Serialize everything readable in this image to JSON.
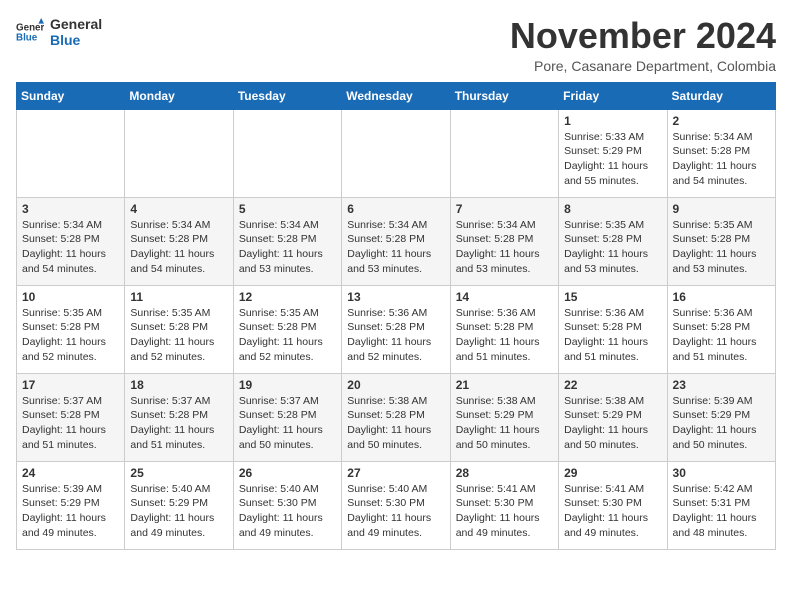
{
  "logo": {
    "line1": "General",
    "line2": "Blue"
  },
  "title": "November 2024",
  "subtitle": "Pore, Casanare Department, Colombia",
  "days_of_week": [
    "Sunday",
    "Monday",
    "Tuesday",
    "Wednesday",
    "Thursday",
    "Friday",
    "Saturday"
  ],
  "weeks": [
    [
      {
        "day": "",
        "info": ""
      },
      {
        "day": "",
        "info": ""
      },
      {
        "day": "",
        "info": ""
      },
      {
        "day": "",
        "info": ""
      },
      {
        "day": "",
        "info": ""
      },
      {
        "day": "1",
        "info": "Sunrise: 5:33 AM\nSunset: 5:29 PM\nDaylight: 11 hours\nand 55 minutes."
      },
      {
        "day": "2",
        "info": "Sunrise: 5:34 AM\nSunset: 5:28 PM\nDaylight: 11 hours\nand 54 minutes."
      }
    ],
    [
      {
        "day": "3",
        "info": "Sunrise: 5:34 AM\nSunset: 5:28 PM\nDaylight: 11 hours\nand 54 minutes."
      },
      {
        "day": "4",
        "info": "Sunrise: 5:34 AM\nSunset: 5:28 PM\nDaylight: 11 hours\nand 54 minutes."
      },
      {
        "day": "5",
        "info": "Sunrise: 5:34 AM\nSunset: 5:28 PM\nDaylight: 11 hours\nand 53 minutes."
      },
      {
        "day": "6",
        "info": "Sunrise: 5:34 AM\nSunset: 5:28 PM\nDaylight: 11 hours\nand 53 minutes."
      },
      {
        "day": "7",
        "info": "Sunrise: 5:34 AM\nSunset: 5:28 PM\nDaylight: 11 hours\nand 53 minutes."
      },
      {
        "day": "8",
        "info": "Sunrise: 5:35 AM\nSunset: 5:28 PM\nDaylight: 11 hours\nand 53 minutes."
      },
      {
        "day": "9",
        "info": "Sunrise: 5:35 AM\nSunset: 5:28 PM\nDaylight: 11 hours\nand 53 minutes."
      }
    ],
    [
      {
        "day": "10",
        "info": "Sunrise: 5:35 AM\nSunset: 5:28 PM\nDaylight: 11 hours\nand 52 minutes."
      },
      {
        "day": "11",
        "info": "Sunrise: 5:35 AM\nSunset: 5:28 PM\nDaylight: 11 hours\nand 52 minutes."
      },
      {
        "day": "12",
        "info": "Sunrise: 5:35 AM\nSunset: 5:28 PM\nDaylight: 11 hours\nand 52 minutes."
      },
      {
        "day": "13",
        "info": "Sunrise: 5:36 AM\nSunset: 5:28 PM\nDaylight: 11 hours\nand 52 minutes."
      },
      {
        "day": "14",
        "info": "Sunrise: 5:36 AM\nSunset: 5:28 PM\nDaylight: 11 hours\nand 51 minutes."
      },
      {
        "day": "15",
        "info": "Sunrise: 5:36 AM\nSunset: 5:28 PM\nDaylight: 11 hours\nand 51 minutes."
      },
      {
        "day": "16",
        "info": "Sunrise: 5:36 AM\nSunset: 5:28 PM\nDaylight: 11 hours\nand 51 minutes."
      }
    ],
    [
      {
        "day": "17",
        "info": "Sunrise: 5:37 AM\nSunset: 5:28 PM\nDaylight: 11 hours\nand 51 minutes."
      },
      {
        "day": "18",
        "info": "Sunrise: 5:37 AM\nSunset: 5:28 PM\nDaylight: 11 hours\nand 51 minutes."
      },
      {
        "day": "19",
        "info": "Sunrise: 5:37 AM\nSunset: 5:28 PM\nDaylight: 11 hours\nand 50 minutes."
      },
      {
        "day": "20",
        "info": "Sunrise: 5:38 AM\nSunset: 5:28 PM\nDaylight: 11 hours\nand 50 minutes."
      },
      {
        "day": "21",
        "info": "Sunrise: 5:38 AM\nSunset: 5:29 PM\nDaylight: 11 hours\nand 50 minutes."
      },
      {
        "day": "22",
        "info": "Sunrise: 5:38 AM\nSunset: 5:29 PM\nDaylight: 11 hours\nand 50 minutes."
      },
      {
        "day": "23",
        "info": "Sunrise: 5:39 AM\nSunset: 5:29 PM\nDaylight: 11 hours\nand 50 minutes."
      }
    ],
    [
      {
        "day": "24",
        "info": "Sunrise: 5:39 AM\nSunset: 5:29 PM\nDaylight: 11 hours\nand 49 minutes."
      },
      {
        "day": "25",
        "info": "Sunrise: 5:40 AM\nSunset: 5:29 PM\nDaylight: 11 hours\nand 49 minutes."
      },
      {
        "day": "26",
        "info": "Sunrise: 5:40 AM\nSunset: 5:30 PM\nDaylight: 11 hours\nand 49 minutes."
      },
      {
        "day": "27",
        "info": "Sunrise: 5:40 AM\nSunset: 5:30 PM\nDaylight: 11 hours\nand 49 minutes."
      },
      {
        "day": "28",
        "info": "Sunrise: 5:41 AM\nSunset: 5:30 PM\nDaylight: 11 hours\nand 49 minutes."
      },
      {
        "day": "29",
        "info": "Sunrise: 5:41 AM\nSunset: 5:30 PM\nDaylight: 11 hours\nand 49 minutes."
      },
      {
        "day": "30",
        "info": "Sunrise: 5:42 AM\nSunset: 5:31 PM\nDaylight: 11 hours\nand 48 minutes."
      }
    ]
  ]
}
